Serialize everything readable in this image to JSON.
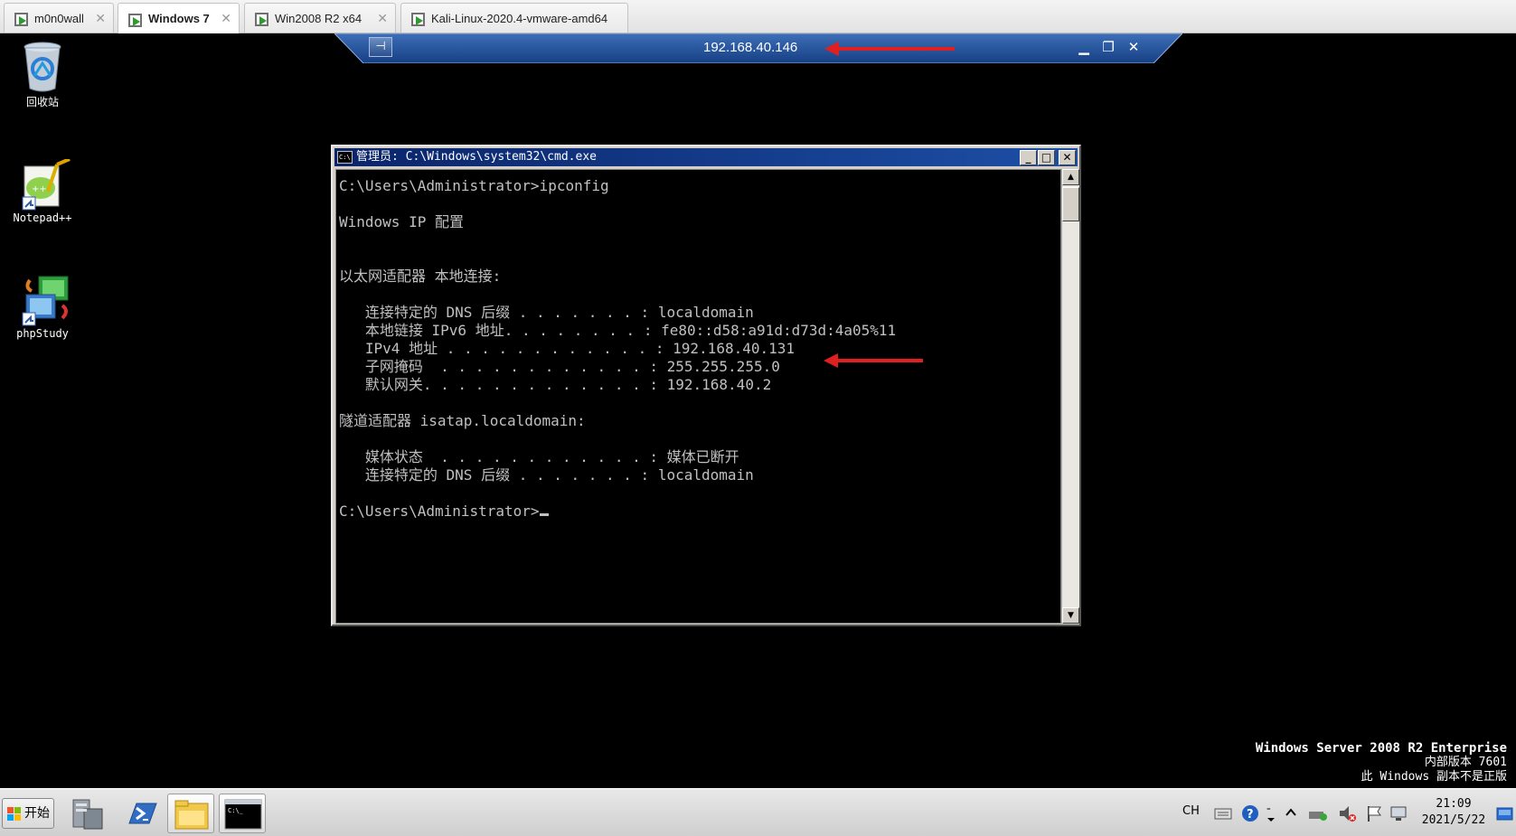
{
  "vmware_tabs": [
    {
      "label": "m0n0wall",
      "active": false
    },
    {
      "label": "Windows 7",
      "active": true
    },
    {
      "label": "Win2008 R2 x64",
      "active": false
    },
    {
      "label": "Kali-Linux-2020.4-vmware-amd64",
      "active": false
    }
  ],
  "remote_bar": {
    "ip": "192.168.40.146"
  },
  "desktop_icons": [
    {
      "label": "回收站",
      "icon": "recycle-bin-icon"
    },
    {
      "label": "Notepad++",
      "icon": "notepadpp-icon"
    },
    {
      "label": "phpStudy",
      "icon": "phpstudy-icon"
    }
  ],
  "cmd_window": {
    "title": "管理员: C:\\Windows\\system32\\cmd.exe",
    "lines": [
      "C:\\Users\\Administrator>ipconfig",
      "",
      "Windows IP 配置",
      "",
      "",
      "以太网适配器 本地连接:",
      "",
      "   连接特定的 DNS 后缀 . . . . . . . : localdomain",
      "   本地链接 IPv6 地址. . . . . . . . : fe80::d58:a91d:d73d:4a05%11",
      "   IPv4 地址 . . . . . . . . . . . . : 192.168.40.131",
      "   子网掩码  . . . . . . . . . . . . : 255.255.255.0",
      "   默认网关. . . . . . . . . . . . . : 192.168.40.2",
      "",
      "隧道适配器 isatap.localdomain:",
      "",
      "   媒体状态  . . . . . . . . . . . . : 媒体已断开",
      "   连接特定的 DNS 后缀 . . . . . . . : localdomain",
      ""
    ],
    "prompt": "C:\\Users\\Administrator>"
  },
  "watermark": {
    "line1": "Windows Server 2008 R2 Enterprise",
    "line2": "内部版本 7601",
    "line3": "此 Windows 副本不是正版"
  },
  "taskbar": {
    "start_label": "开始",
    "lang": "CH",
    "time": "21:09",
    "date": "2021/5/22"
  },
  "colors": {
    "arrow": "#e0201f",
    "titlebar": "#0a246a",
    "rdbar": "#1e4f9b"
  }
}
